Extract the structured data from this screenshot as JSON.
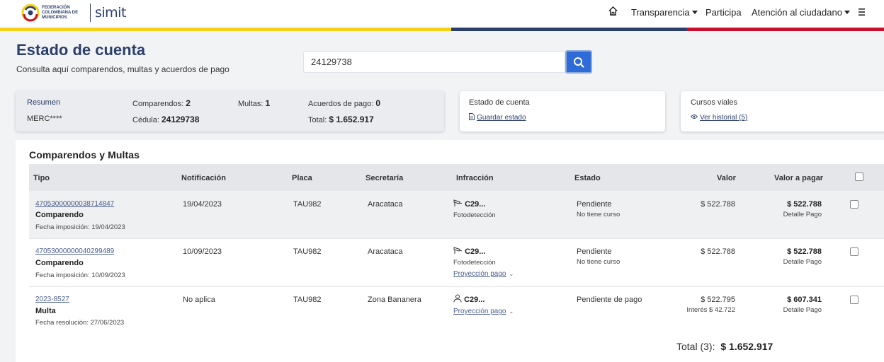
{
  "header": {
    "logo_text": "Federación Colombiana de Municipios",
    "logo_simit": "simit",
    "nav": {
      "home_icon": "home-icon",
      "transparencia": "Transparencia",
      "participa": "Participa",
      "atencion": "Atención al ciudadano",
      "menu_icon": "hamburger-icon"
    },
    "stripe_colors": [
      "#f7d117",
      "#2b3f6c",
      "#c8102e"
    ]
  },
  "page": {
    "title": "Estado de cuenta",
    "subtitle": "Consulta aquí comparendos, multas y acuerdos de pago",
    "search_value": "24129738"
  },
  "summary": {
    "heading": "Resumen",
    "name": "MERC****",
    "comparendos_label": "Comparendos:",
    "comparendos_value": "2",
    "multas_label": "Multas:",
    "multas_value": "1",
    "acuerdos_label": "Acuerdos de pago:",
    "acuerdos_value": "0",
    "cedula_label": "Cédula:",
    "cedula_value": "24129738",
    "total_label": "Total:",
    "total_value": "$ 1.652.917"
  },
  "estado_card": {
    "title": "Estado de cuenta",
    "link": "Guardar estado"
  },
  "cursos_card": {
    "title": "Cursos viales",
    "link": "Ver historial (5)"
  },
  "table": {
    "title": "Comparendos y Multas",
    "headers": [
      "Tipo",
      "Notificación",
      "Placa",
      "Secretaría",
      "Infracción",
      "Estado",
      "Valor",
      "Valor a pagar"
    ],
    "rows": [
      {
        "id": "47053000000038714847",
        "tipo": "Comparendo",
        "fecha": "Fecha imposición: 19/04/2023",
        "notificacion": "19/04/2023",
        "placa": "TAU982",
        "secretaria": "Aracataca",
        "infraccion": "C29...",
        "infraccion_sub": "Fotodetección",
        "estado": "Pendiente",
        "estado_sub": "No tiene curso",
        "valor": "$ 522.788",
        "valor_pagar": "$ 522.788",
        "detalle": "Detalle Pago"
      },
      {
        "id": "47053000000040299489",
        "tipo": "Comparendo",
        "fecha": "Fecha imposición: 10/09/2023",
        "notificacion": "10/09/2023",
        "placa": "TAU982",
        "secretaria": "Aracataca",
        "infraccion": "C29...",
        "infraccion_sub": "Fotodetección",
        "proyeccion": "Proyección pago",
        "estado": "Pendiente",
        "estado_sub": "No tiene curso",
        "valor": "$ 522.788",
        "valor_pagar": "$ 522.788",
        "detalle": "Detalle Pago"
      },
      {
        "id": "2023-8527",
        "tipo": "Multa",
        "fecha": "Fecha resolución: 27/06/2023",
        "notificacion": "No aplica",
        "placa": "TAU982",
        "secretaria": "Zona Bananera",
        "infraccion": "C29...",
        "proyeccion": "Proyección pago",
        "estado": "Pendiente de pago",
        "valor": "$ 522.795",
        "valor_sub": "Interés $ 42.722",
        "valor_pagar": "$ 607.341",
        "detalle": "Detalle Pago"
      }
    ],
    "total_label": "Total (3):",
    "total_value": "$ 1.652.917"
  }
}
